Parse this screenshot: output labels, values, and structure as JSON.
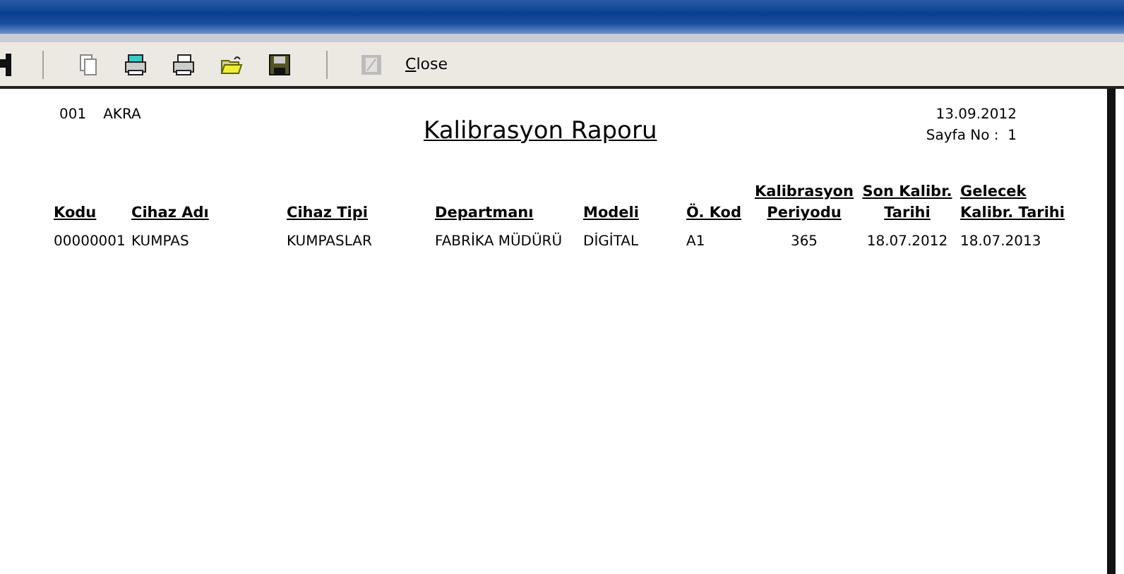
{
  "toolbar": {
    "items": [
      {
        "kind": "cut-tool",
        "disabled": false
      },
      {
        "kind": "separator"
      },
      {
        "kind": "pages",
        "disabled": false
      },
      {
        "kind": "printer-setup",
        "disabled": false
      },
      {
        "kind": "printer",
        "disabled": false
      },
      {
        "kind": "open",
        "disabled": false
      },
      {
        "kind": "save",
        "disabled": false
      },
      {
        "kind": "separator"
      },
      {
        "kind": "export",
        "disabled": true
      },
      {
        "kind": "text",
        "label": "Close",
        "disabled": false
      }
    ]
  },
  "report": {
    "company_code": "001",
    "company_name": "AKRA",
    "title": "Kalibrasyon Raporu",
    "date": "13.09.2012",
    "page": "Sayfa No :  1",
    "table": {
      "columns": [
        "Kodu",
        "Cihaz Adı",
        "Cihaz Tipi",
        "Departmanı",
        "Modeli",
        "Ö. Kod",
        "Kalibrasyon\nPeriyodu",
        "Son Kalibr.\nTarihi",
        "Gelecek\nKalibr. Tarihi"
      ],
      "rows": [
        [
          "00000001",
          "KUMPAS",
          "KUMPASLAR",
          "FABRİKA MÜDÜRÜ",
          "DİGİTAL",
          "A1",
          "365",
          "18.07.2012",
          "18.07.2013"
        ]
      ]
    }
  }
}
